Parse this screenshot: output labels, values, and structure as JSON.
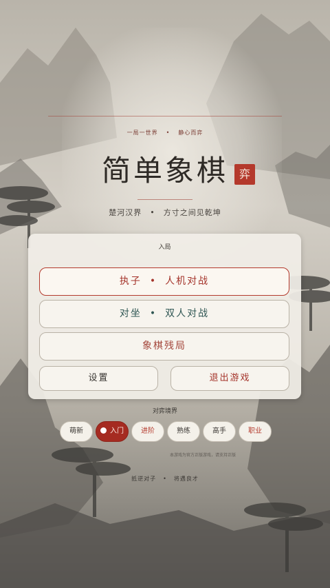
{
  "header": {
    "motto_left": "一局一世界",
    "motto_sep": "•",
    "motto_right": "静心而弈",
    "title": "简单象棋",
    "seal": "弈",
    "subtitle_left": "楚河汉界",
    "subtitle_sep": "•",
    "subtitle_right": "方寸之间见乾坤"
  },
  "menu": {
    "section_label": "入局",
    "ai_mode_left": "执子",
    "ai_mode_sep": "•",
    "ai_mode_right": "人机对战",
    "pvp_mode_left": "对坐",
    "pvp_mode_sep": "•",
    "pvp_mode_right": "双人对战",
    "endgame_label": "象棋残局",
    "settings_label": "设置",
    "exit_label": "退出游戏"
  },
  "difficulty": {
    "label": "对弈境界",
    "levels": [
      "萌新",
      "入门",
      "进阶",
      "熟练",
      "高手",
      "职业"
    ],
    "selected": "入门"
  },
  "footer": {
    "note": "本游戏为官方正版游戏，请支持正版",
    "left": "抵逆对子",
    "sep": "•",
    "right": "将遇良才"
  },
  "colors": {
    "accent_red": "#a52b21",
    "ink": "#2e2a26",
    "teal_text": "#2f5653"
  }
}
